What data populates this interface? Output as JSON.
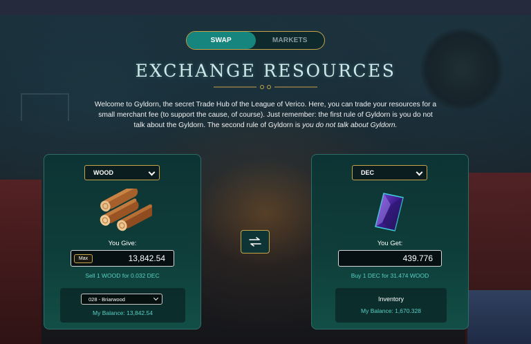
{
  "tabs": [
    {
      "label": "SWAP",
      "active": true
    },
    {
      "label": "MARKETS",
      "active": false
    }
  ],
  "title": "EXCHANGE RESOURCES",
  "intro": {
    "text_main": "Welcome to Gyldorn, the secret Trade Hub of the League of Verico. Here, you can trade your resources for a small merchant fee (to support the cause, of course). Just remember: the first rule of Gyldorn is you do not talk about the Gyldorn. The second rule of Gyldorn is ",
    "text_emph": "you do not talk about Gyldorn."
  },
  "give": {
    "resource": "WOOD",
    "icon": "wood-logs-icon",
    "label": "You Give:",
    "max_label": "Max",
    "amount": "13,842.54",
    "rate": "Sell 1 WOOD for 0.032 DEC",
    "land": "028 - Briarwood",
    "balance": "My Balance: 13,842.54"
  },
  "get": {
    "resource": "DEC",
    "icon": "dec-crystal-icon",
    "label": "You Get:",
    "amount": "439.776",
    "rate": "Buy 1 DEC for 31.474 WOOD",
    "inventory_label": "Inventory",
    "balance": "My Balance: 1,670.328"
  },
  "colors": {
    "accent_teal": "#16857d",
    "gold_border": "#c9a54a",
    "rate_text": "#58d0c6",
    "title": "#cfe9ea"
  }
}
